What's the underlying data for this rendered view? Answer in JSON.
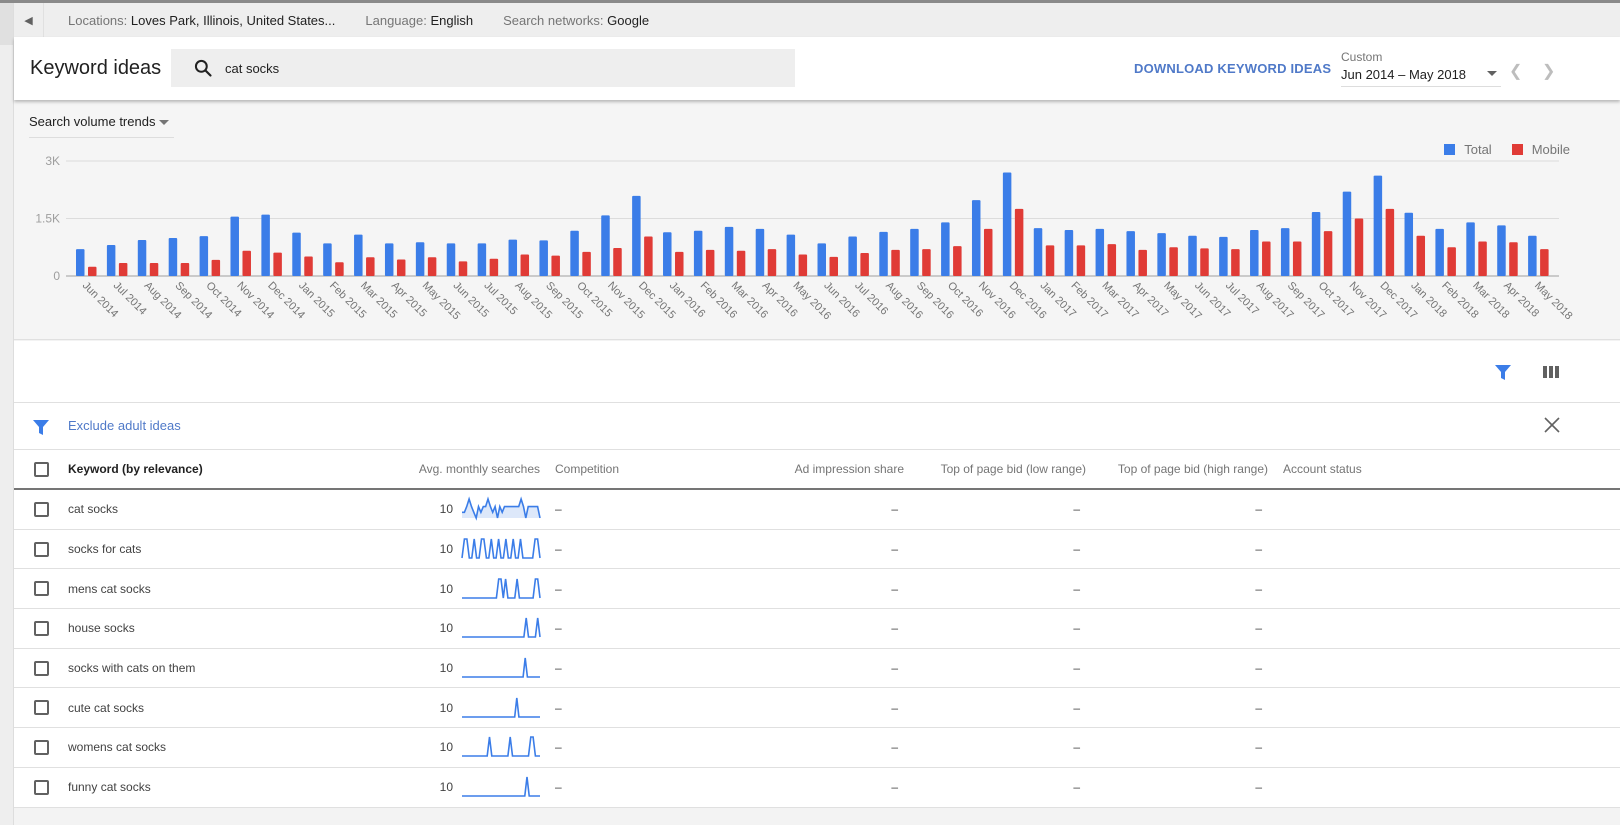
{
  "location_bar": {
    "back_icon": "triangle-left-icon",
    "locations_label": "Locations:",
    "locations_value": "Loves Park, Illinois, United States...",
    "language_label": "Language:",
    "language_value": "English",
    "networks_label": "Search networks:",
    "networks_value": "Google"
  },
  "header": {
    "title": "Keyword ideas",
    "search_icon": "search-icon",
    "search_value": "cat socks",
    "download_label": "DOWNLOAD KEYWORD IDEAS",
    "date_range_label": "Custom",
    "date_range_value": "Jun 2014 – May 2018",
    "prev_icon": "chevron-left-icon",
    "next_icon": "chevron-right-icon"
  },
  "chart_panel": {
    "selector_label": "Search volume trends"
  },
  "colors": {
    "total": "#3b7de8",
    "mobile": "#e03b36",
    "accent": "#4f79c8"
  },
  "chart_data": {
    "type": "bar",
    "title": "Search volume trends",
    "xlabel": "",
    "ylabel": "",
    "ylim": [
      0,
      3000
    ],
    "yticks": [
      0,
      1500,
      3000
    ],
    "ytick_labels": [
      "0",
      "1.5K",
      "3K"
    ],
    "grid": true,
    "legend_position": "top-right",
    "categories": [
      "Jun 2014",
      "Jul 2014",
      "Aug 2014",
      "Sep 2014",
      "Oct 2014",
      "Nov 2014",
      "Dec 2014",
      "Jan 2015",
      "Feb 2015",
      "Mar 2015",
      "Apr 2015",
      "May 2015",
      "Jun 2015",
      "Jul 2015",
      "Aug 2015",
      "Sep 2015",
      "Oct 2015",
      "Nov 2015",
      "Dec 2015",
      "Jan 2016",
      "Feb 2016",
      "Mar 2016",
      "Apr 2016",
      "May 2016",
      "Jun 2016",
      "Jul 2016",
      "Aug 2016",
      "Sep 2016",
      "Oct 2016",
      "Nov 2016",
      "Dec 2016",
      "Jan 2017",
      "Feb 2017",
      "Mar 2017",
      "Apr 2017",
      "May 2017",
      "Jun 2017",
      "Jul 2017",
      "Aug 2017",
      "Sep 2017",
      "Oct 2017",
      "Nov 2017",
      "Dec 2017",
      "Jan 2018",
      "Feb 2018",
      "Mar 2018",
      "Apr 2018",
      "May 2018"
    ],
    "series": [
      {
        "name": "Total",
        "values": [
          700,
          810,
          940,
          990,
          1040,
          1550,
          1600,
          1130,
          850,
          1080,
          850,
          880,
          850,
          850,
          950,
          930,
          1180,
          1580,
          2090,
          1140,
          1180,
          1280,
          1230,
          1080,
          850,
          1030,
          1150,
          1230,
          1400,
          1980,
          2700,
          1250,
          1200,
          1230,
          1170,
          1120,
          1050,
          1020,
          1200,
          1250,
          1670,
          2200,
          2620,
          1650,
          1230,
          1400,
          1320,
          1050
        ]
      },
      {
        "name": "Mobile",
        "values": [
          240,
          340,
          340,
          340,
          420,
          660,
          610,
          510,
          360,
          490,
          430,
          490,
          380,
          450,
          560,
          530,
          630,
          730,
          1030,
          630,
          680,
          660,
          700,
          560,
          500,
          600,
          680,
          700,
          780,
          1230,
          1750,
          800,
          800,
          830,
          680,
          750,
          720,
          700,
          900,
          900,
          1170,
          1500,
          1750,
          1050,
          750,
          900,
          880,
          700
        ]
      }
    ]
  },
  "toolbar": {
    "filter_icon": "filter-icon",
    "columns_icon": "columns-icon"
  },
  "filter_bar": {
    "filter_icon": "filter-icon",
    "chip_label": "Exclude adult ideas",
    "close_icon": "close-icon"
  },
  "table": {
    "columns": {
      "keyword": "Keyword (by relevance)",
      "avg": "Avg. monthly searches",
      "competition": "Competition",
      "ad_share": "Ad impression share",
      "bid_low": "Top of page bid (low range)",
      "bid_high": "Top of page bid (high range)",
      "account_status": "Account status"
    },
    "rows": [
      {
        "keyword": "cat socks",
        "avg": "10",
        "competition": "–",
        "ad_share": "–",
        "bid_low": "–",
        "bid_high": "–",
        "account_status": "",
        "trend": [
          0.3,
          0.3,
          0.6,
          1,
          0.6,
          0.3,
          0,
          0.6,
          0.3,
          0.6,
          0.6,
          1,
          0.6,
          0.3,
          0.6,
          0,
          0.6,
          0.3,
          0.6,
          0.6,
          0.6,
          0.6,
          0.6,
          0.6,
          0.6,
          1,
          0.6,
          0,
          0.6,
          0.6,
          0.6,
          0.6,
          0.6,
          0
        ]
      },
      {
        "keyword": "socks for cats",
        "avg": "10",
        "competition": "–",
        "ad_share": "–",
        "bid_low": "–",
        "bid_high": "–",
        "account_status": "",
        "trend": [
          0,
          1,
          1,
          0,
          0,
          1,
          0,
          0,
          1,
          1,
          0,
          0,
          1,
          0,
          0,
          1,
          0,
          0,
          1,
          0,
          0,
          1,
          0,
          0,
          1,
          0,
          0,
          0,
          0,
          0,
          1,
          1,
          0
        ]
      },
      {
        "keyword": "mens cat socks",
        "avg": "10",
        "competition": "–",
        "ad_share": "–",
        "bid_low": "–",
        "bid_high": "–",
        "account_status": "",
        "trend": [
          0,
          0,
          0,
          0,
          0,
          0,
          0,
          0,
          0,
          0,
          0,
          0,
          0,
          0,
          0,
          0,
          1,
          1,
          0,
          1,
          0,
          0,
          0,
          0,
          1,
          0,
          0,
          0,
          0,
          0,
          0,
          0,
          1,
          1,
          0
        ]
      },
      {
        "keyword": "house socks",
        "avg": "10",
        "competition": "–",
        "ad_share": "–",
        "bid_low": "–",
        "bid_high": "–",
        "account_status": "",
        "trend": [
          0,
          0,
          0,
          0,
          0,
          0,
          0,
          0,
          0,
          0,
          0,
          0,
          0,
          0,
          0,
          0,
          0,
          0,
          0,
          0,
          0,
          0,
          0,
          0,
          0,
          0,
          0,
          0,
          1,
          0,
          0,
          0,
          0,
          1,
          0
        ]
      },
      {
        "keyword": "socks with cats on them",
        "avg": "10",
        "competition": "–",
        "ad_share": "–",
        "bid_low": "–",
        "bid_high": "–",
        "account_status": "",
        "trend": [
          0,
          0,
          0,
          0,
          0,
          0,
          0,
          0,
          0,
          0,
          0,
          0,
          0,
          0,
          0,
          0,
          0,
          0,
          0,
          0,
          0,
          0,
          0,
          0,
          0,
          0,
          0,
          0,
          0,
          0,
          1,
          0,
          0,
          0,
          0,
          0,
          0,
          0
        ]
      },
      {
        "keyword": "cute cat socks",
        "avg": "10",
        "competition": "–",
        "ad_share": "–",
        "bid_low": "–",
        "bid_high": "–",
        "account_status": "",
        "trend": [
          0,
          0,
          0,
          0,
          0,
          0,
          0,
          0,
          0,
          0,
          0,
          0,
          0,
          0,
          0,
          0,
          0,
          0,
          0,
          0,
          0,
          0,
          0,
          0,
          0,
          0,
          1,
          0,
          0,
          0,
          0,
          0,
          0,
          0,
          0,
          0,
          0,
          0
        ]
      },
      {
        "keyword": "womens cat socks",
        "avg": "10",
        "competition": "–",
        "ad_share": "–",
        "bid_low": "–",
        "bid_high": "–",
        "account_status": "",
        "trend": [
          0,
          0,
          0,
          0,
          0,
          0,
          0,
          0,
          0,
          0,
          0,
          0,
          1,
          0,
          0,
          0,
          0,
          0,
          0,
          0,
          0,
          1,
          0,
          0,
          0,
          0,
          0,
          0,
          0,
          0,
          1,
          1,
          0,
          0,
          0
        ]
      },
      {
        "keyword": "funny cat socks",
        "avg": "10",
        "competition": "–",
        "ad_share": "–",
        "bid_low": "–",
        "bid_high": "–",
        "account_status": "",
        "trend": [
          0,
          0,
          0,
          0,
          0,
          0,
          0,
          0,
          0,
          0,
          0,
          0,
          0,
          0,
          0,
          0,
          0,
          0,
          0,
          0,
          0,
          0,
          0,
          0,
          0,
          0,
          0,
          0,
          0,
          0,
          1,
          0,
          0,
          0,
          0,
          0,
          0
        ]
      }
    ]
  }
}
